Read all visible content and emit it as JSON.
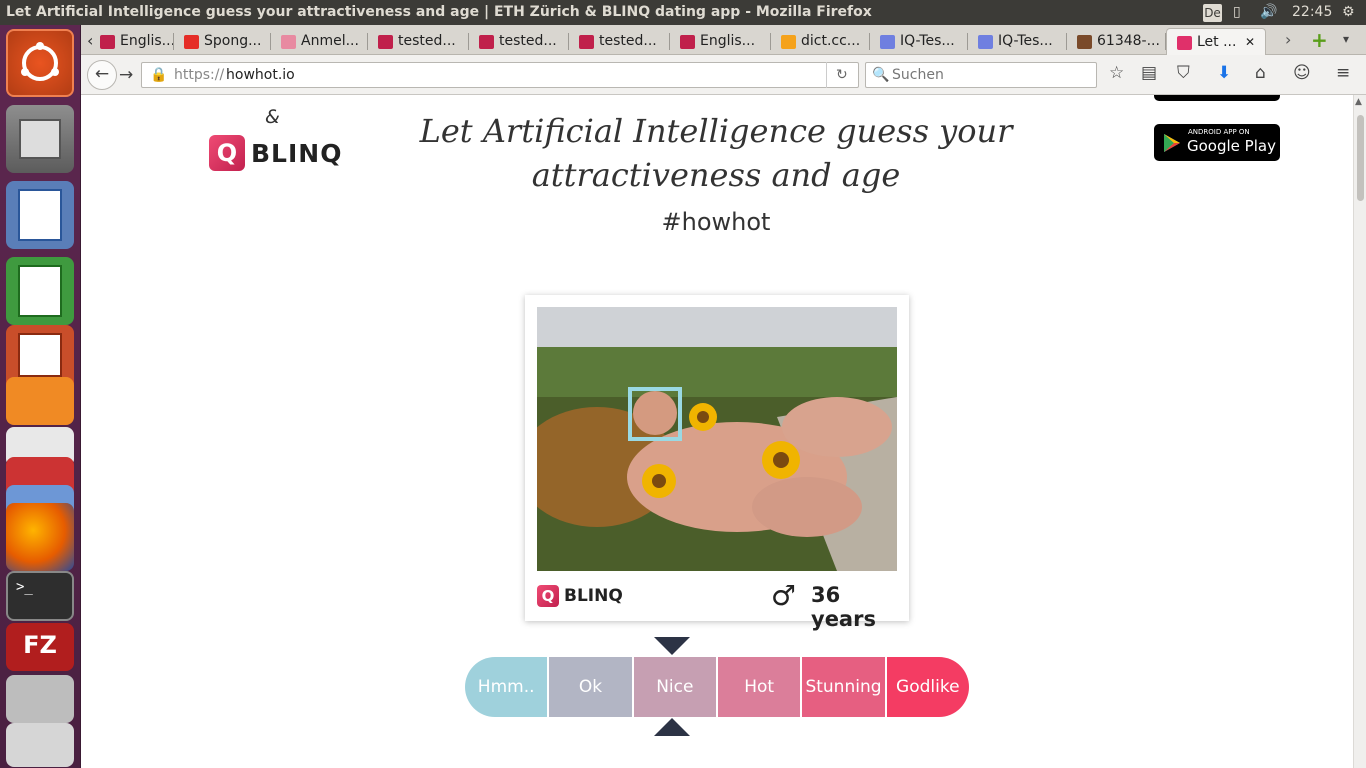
{
  "window": {
    "title": "Let Artificial Intelligence guess your attractiveness and age | ETH Zürich & BLINQ dating app - Mozilla Firefox",
    "keyboard": "De",
    "clock": "22:45"
  },
  "tabs": [
    {
      "label": "Englis...",
      "icon": "check-icon",
      "color": "#c0204b"
    },
    {
      "label": "Spong...",
      "icon": "youtube-icon",
      "color": "#e52d27"
    },
    {
      "label": "Anmel...",
      "icon": "pig-icon",
      "color": "#e88aa1"
    },
    {
      "label": "tested...",
      "icon": "check-icon",
      "color": "#c0204b"
    },
    {
      "label": "tested...",
      "icon": "check-icon",
      "color": "#c0204b"
    },
    {
      "label": "tested...",
      "icon": "check-icon",
      "color": "#c0204b"
    },
    {
      "label": "Englis...",
      "icon": "check-icon",
      "color": "#c0204b"
    },
    {
      "label": "dict.cc...",
      "icon": "dict-icon",
      "color": "#f5a21b"
    },
    {
      "label": "IQ-Tes...",
      "icon": "iq-icon",
      "color": "#6f7fe0"
    },
    {
      "label": "IQ-Tes...",
      "icon": "iq-icon",
      "color": "#6f7fe0"
    },
    {
      "label": "61348-...",
      "icon": "image-icon",
      "color": "#7a4a2a"
    },
    {
      "label": "Let ...",
      "icon": "blinq-icon",
      "color": "#e0306a"
    }
  ],
  "nav": {
    "url_prefix": "https://",
    "url_host": "howhot.io",
    "search_placeholder": "Suchen"
  },
  "page": {
    "ampersand": "&",
    "brand": "BLINQ",
    "brand_q": "Q",
    "title": "Let Artificial Intelligence guess your attractiveness and age",
    "hashtag": "#howhot",
    "store": {
      "small": "ANDROID APP ON",
      "big": "Google Play"
    },
    "result": {
      "gender_symbol": "♂",
      "age": "36 years"
    },
    "rating": [
      "Hmm..",
      "Ok",
      "Nice",
      "Hot",
      "Stunning",
      "Godlike"
    ],
    "selected_rating": "Nice"
  },
  "colors": {
    "rating": [
      "#9fd1dc",
      "#b2b5c4",
      "#c69fb2",
      "#db7e9a",
      "#e65f81",
      "#f43c63"
    ],
    "accent": "#e0306a"
  }
}
